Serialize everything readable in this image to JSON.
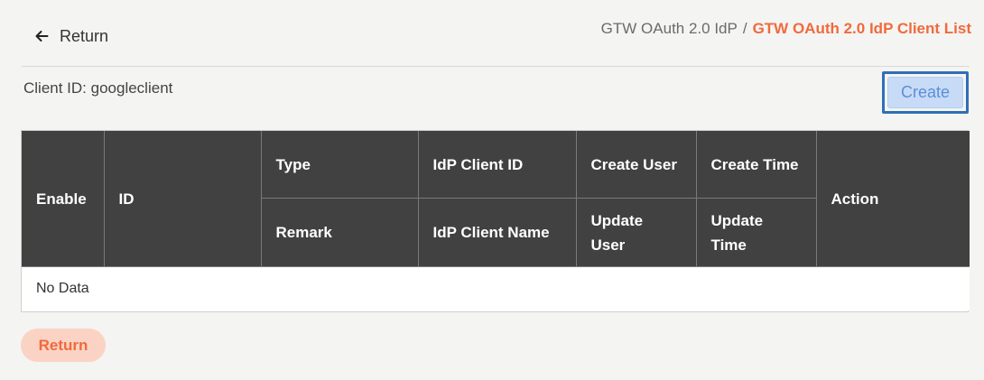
{
  "header": {
    "return_label": "Return",
    "breadcrumb": {
      "parent": "GTW OAuth 2.0 IdP",
      "separator": "/",
      "current": "GTW OAuth 2.0 IdP Client List"
    }
  },
  "info": {
    "client_id_text": "Client ID: googleclient"
  },
  "toolbar": {
    "create_label": "Create"
  },
  "table": {
    "headers": {
      "enable": "Enable",
      "id": "ID",
      "type": "Type",
      "idp_client_id": "IdP Client ID",
      "create_user": "Create User",
      "create_time": "Create Time",
      "remark": "Remark",
      "idp_client_name": "IdP Client Name",
      "update_user": "Update User",
      "update_time": "Update Time",
      "action": "Action"
    },
    "empty_text": "No Data"
  },
  "footer": {
    "return_label": "Return"
  },
  "colors": {
    "accent": "#f06a3c",
    "header_bg": "#414141",
    "create_bg": "#c7dbf6",
    "create_text": "#5b8fd8",
    "focus_ring": "#2f6fb7"
  }
}
